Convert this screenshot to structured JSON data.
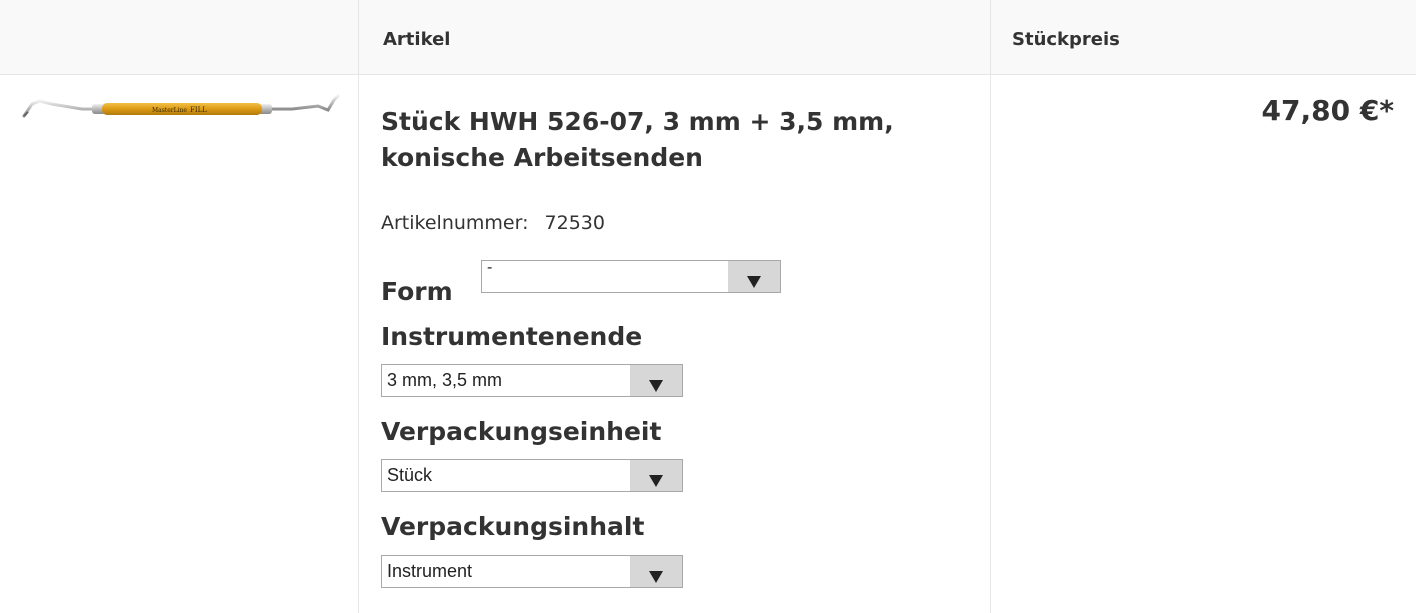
{
  "table": {
    "headers": {
      "artikel": "Artikel",
      "stueckpreis": "Stückpreis"
    }
  },
  "product": {
    "image_icon": "dental-instrument-image",
    "title": "Stück HWH 526-07, 3 mm + 3,5 mm, konische Arbeitsenden",
    "artnr_label": "Artikelnummer:",
    "artnr_value": "72530",
    "price": "47,80 €*",
    "options": {
      "form": {
        "label": "Form",
        "value": "-"
      },
      "instrumentenende": {
        "label": "Instrumentenende",
        "value": "3 mm, 3,5 mm"
      },
      "verpackungseinheit": {
        "label": "Verpackungseinheit",
        "value": "Stück"
      },
      "verpackungsinhalt": {
        "label": "Verpackungsinhalt",
        "value": "Instrument"
      }
    }
  },
  "colors": {
    "header_bg": "#f9f9f9",
    "border": "#e6e6e6",
    "text": "#333333",
    "instrument_gold": "#e0a21c",
    "select_button": "#d7d7d7"
  }
}
